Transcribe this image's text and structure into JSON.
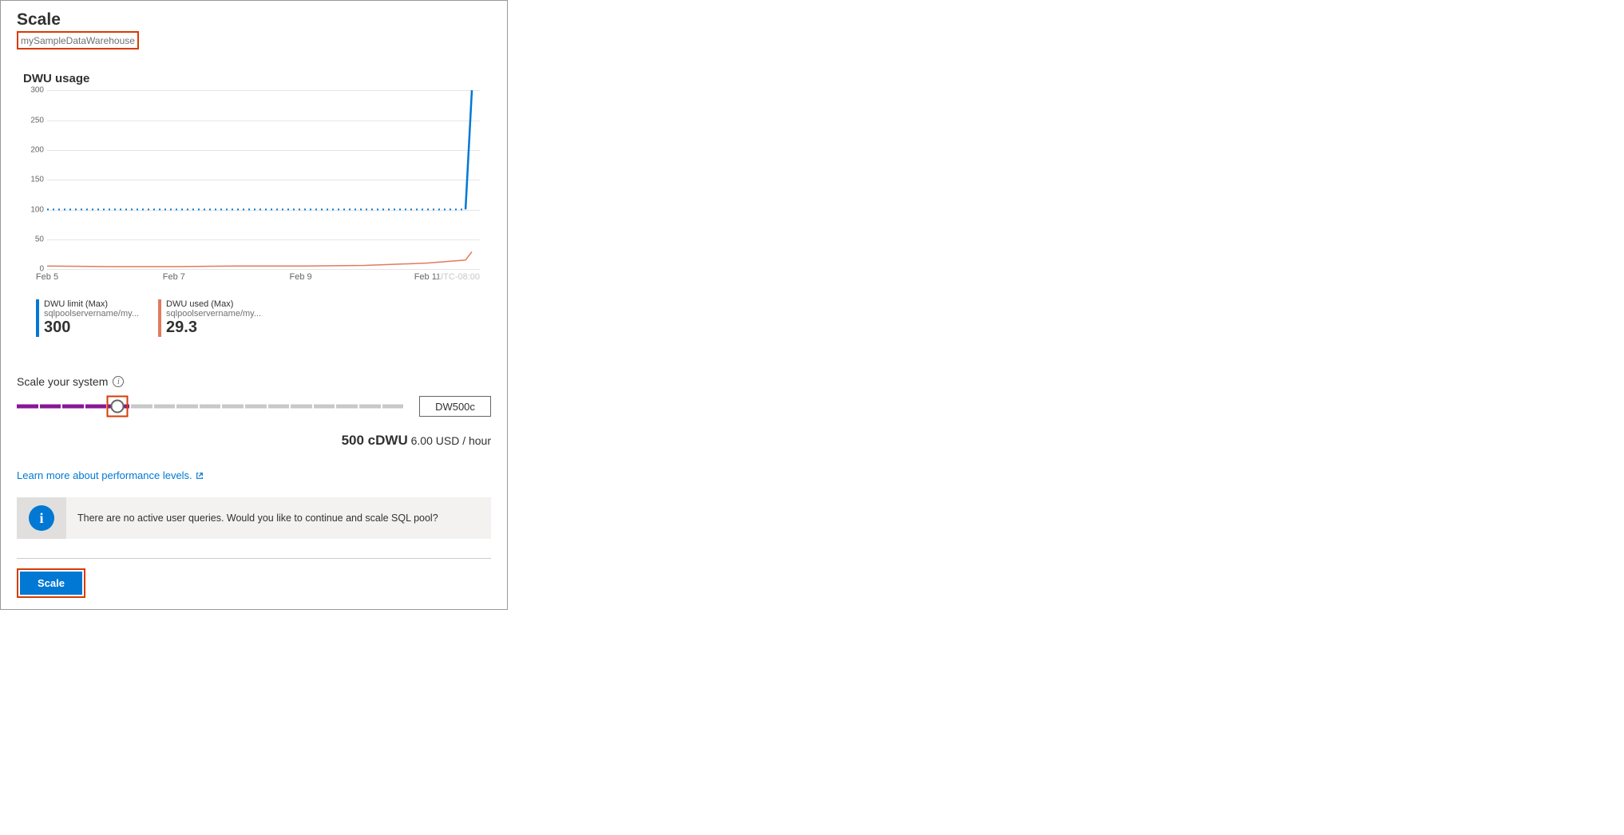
{
  "header": {
    "title": "Scale",
    "resource_name": "mySampleDataWarehouse"
  },
  "usage": {
    "label": "DWU usage"
  },
  "chart_data": {
    "type": "line",
    "xlabel": "",
    "ylabel": "",
    "ylim": [
      0,
      300
    ],
    "y_ticks": [
      0,
      50,
      100,
      150,
      200,
      250,
      300
    ],
    "x_ticks": [
      "Feb 5",
      "Feb 7",
      "Feb 9",
      "Feb 11"
    ],
    "timezone": "UTC-08:00",
    "x": [
      0,
      1,
      2,
      3,
      4,
      5,
      6,
      6.6,
      6.7
    ],
    "series": [
      {
        "name": "DWU limit (Max)",
        "color": "#0078d4",
        "style_hint": "dotted-then-solid",
        "values": [
          100,
          100,
          100,
          100,
          100,
          100,
          100,
          100,
          300
        ]
      },
      {
        "name": "DWU used (Max)",
        "color": "#e07b5f",
        "style_hint": "solid",
        "values": [
          5,
          4,
          4,
          5,
          5,
          6,
          10,
          15,
          29
        ]
      }
    ]
  },
  "legend": [
    {
      "label": "DWU limit (Max)",
      "sub": "sqlpoolservername/my...",
      "value": "300",
      "color": "#0078d4"
    },
    {
      "label": "DWU used (Max)",
      "sub": "sqlpoolservername/my...",
      "value": "29.3",
      "color": "#e07b5f"
    }
  ],
  "scale": {
    "label": "Scale your system",
    "slider_position_pct": 26,
    "total_segments": 17,
    "filled_segments": 5,
    "value_display": "DW500c",
    "cost_big": "500 cDWU",
    "cost_small": "6.00 USD / hour"
  },
  "link": {
    "text": "Learn more about performance levels."
  },
  "infobar": {
    "message": "There are no active user queries. Would you like to continue and scale SQL pool?"
  },
  "footer": {
    "button": "Scale"
  }
}
